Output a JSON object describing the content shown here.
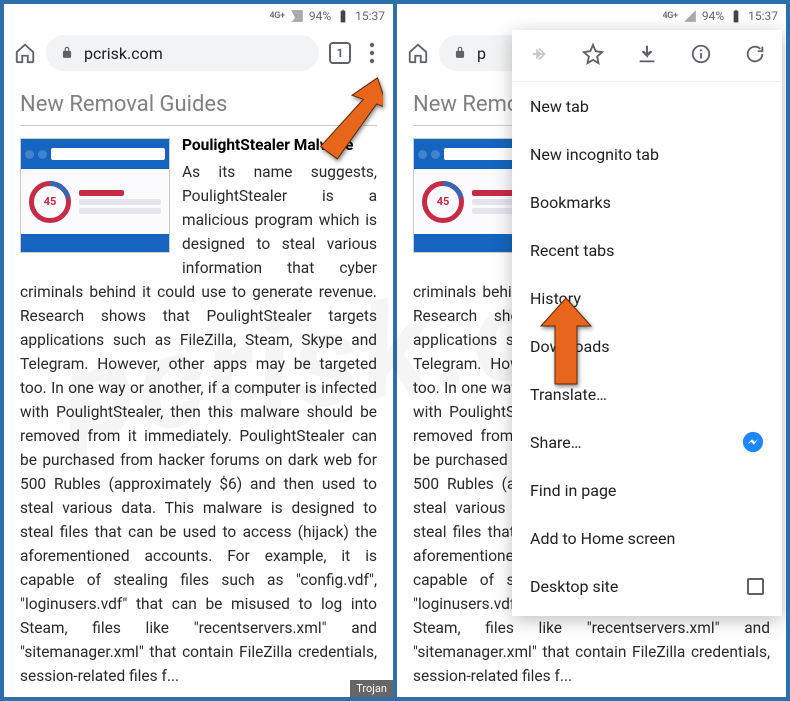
{
  "status": {
    "net": "4G+",
    "battery_pct": "94%",
    "time": "15:37"
  },
  "browser": {
    "url": "pcrisk.com",
    "tabs": "1"
  },
  "page": {
    "heading": "New Removal Guides",
    "title": "PoulightStealer Malware",
    "gauge": "45",
    "body": "As its name suggests, PoulightStealer is a malicious program which is designed to steal various information that cyber criminals behind it could use to generate revenue. Research shows that PoulightStealer targets applications such as FileZilla, Steam, Skype and Telegram. However, other apps may be targeted too. In one way or another, if a computer is infected with PoulightStealer, then this malware should be removed from it immediately. PoulightStealer can be purchased from hacker forums on dark web for 500 Rubles (approximately $6) and then used to steal various data. This malware is designed to steal files that can be used to access (hijack) the aforementioned accounts. For example, it is capable of stealing files such as \"config.vdf\", \"loginusers.vdf\" that can be misused to log into Steam, files like \"recentservers.xml\" and \"sitemanager.xml\" that contain FileZilla credentials, session-related files f...",
    "tag": "Trojan"
  },
  "menu": {
    "items": [
      "New tab",
      "New incognito tab",
      "Bookmarks",
      "Recent tabs",
      "History",
      "Downloads",
      "Translate…",
      "Share…",
      "Find in page",
      "Add to Home screen",
      "Desktop site"
    ]
  },
  "icons": {
    "forward": "forward-icon",
    "star": "star-icon",
    "download": "download-icon",
    "info": "info-icon",
    "reload": "reload-icon"
  },
  "watermark": "pcrisk.com"
}
